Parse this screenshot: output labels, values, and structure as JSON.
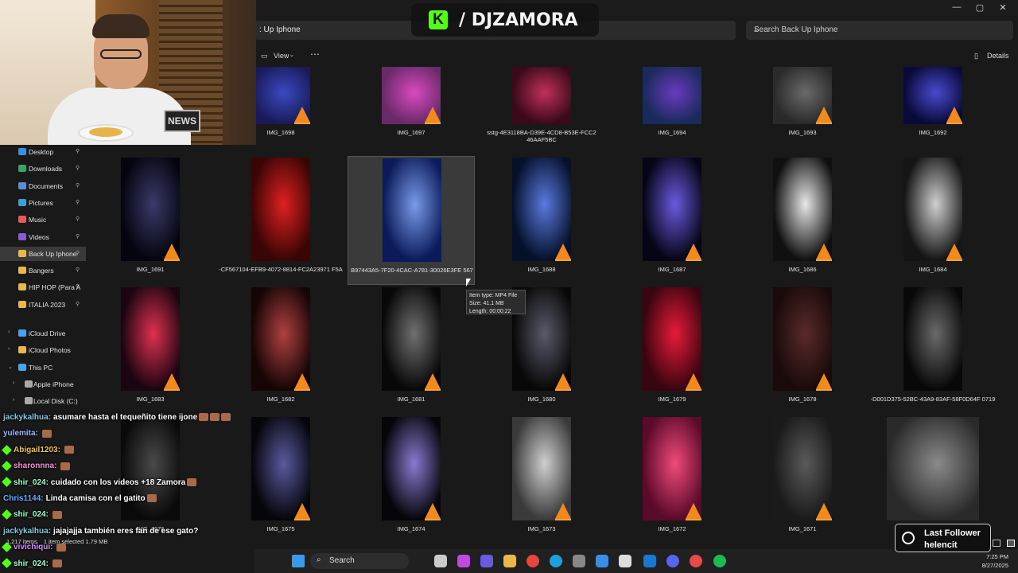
{
  "brand": {
    "name": "/ DJZAMORA",
    "logo_letter": "K",
    "accent": "#53fc18"
  },
  "window": {
    "minimize": "—",
    "maximize": "▢",
    "close": "✕"
  },
  "address": {
    "path": ": Up Iphone"
  },
  "search": {
    "placeholder": "Search Back Up Iphone",
    "icon": "search-icon"
  },
  "toolbar": {
    "view_label": "View",
    "more_label": "⋯",
    "details_label": "Details"
  },
  "webcam": {
    "sign_text": "NEWS"
  },
  "nav": {
    "quick_access": [
      {
        "label": "Desktop",
        "icon": "desktop-icon",
        "color": "#3a8ee6"
      },
      {
        "label": "Downloads",
        "icon": "download-icon",
        "color": "#3aa36b"
      },
      {
        "label": "Documents",
        "icon": "document-icon",
        "color": "#5a8fd6"
      },
      {
        "label": "Pictures",
        "icon": "picture-icon",
        "color": "#3aa0d8"
      },
      {
        "label": "Music",
        "icon": "music-icon",
        "color": "#e25a5a"
      },
      {
        "label": "Videos",
        "icon": "video-icon",
        "color": "#8a5ad6"
      },
      {
        "label": "Back Up Iphone",
        "icon": "folder-icon",
        "color": "#e8b84a",
        "selected": true
      },
      {
        "label": "Bangers",
        "icon": "folder-icon",
        "color": "#e8b84a"
      },
      {
        "label": "HIP HOP (Para A",
        "icon": "folder-icon",
        "color": "#e8b84a"
      },
      {
        "label": "ITALIA 2023",
        "icon": "folder-icon",
        "color": "#e8b84a"
      }
    ],
    "tree": [
      {
        "label": "iCloud Drive",
        "icon": "cloud-icon",
        "color": "#4aa3ea",
        "indent": 0,
        "chev": "›"
      },
      {
        "label": "iCloud Photos",
        "icon": "folder-icon",
        "color": "#e8b84a",
        "indent": 0,
        "chev": "›"
      },
      {
        "label": "This PC",
        "icon": "pc-icon",
        "color": "#4aa3ea",
        "indent": 0,
        "chev": "⌄"
      },
      {
        "label": "Apple iPhone",
        "icon": "phone-icon",
        "color": "#aaaaaa",
        "indent": 1,
        "chev": "›"
      },
      {
        "label": "Local Disk (C:)",
        "icon": "disk-icon",
        "color": "#aaaaaa",
        "indent": 1,
        "chev": "›"
      }
    ]
  },
  "files": [
    {
      "name": "IMG_1698",
      "colors": [
        "#1a1a5a",
        "#3a4ac0"
      ],
      "cone": true
    },
    {
      "name": "IMG_1697",
      "colors": [
        "#6a2a6a",
        "#d84ac0"
      ],
      "cone": true
    },
    {
      "name": "sstg-4E3118BA-D39E-4CD8-B53E-FCC2 46AAF5BC",
      "colors": [
        "#3a0a1a",
        "#c0305a"
      ],
      "cone": false
    },
    {
      "name": "IMG_1694",
      "colors": [
        "#1a2a5a",
        "#6a3ac0"
      ],
      "cone": false
    },
    {
      "name": "IMG_1693",
      "colors": [
        "#2a2a2a",
        "#6a6a6a"
      ],
      "cone": true
    },
    {
      "name": "IMG_1692",
      "colors": [
        "#0a0a3a",
        "#4a4ad0"
      ],
      "cone": true
    },
    {
      "name": "IMG_1691",
      "colors": [
        "#050510",
        "#3a3a6a"
      ],
      "cone": true
    },
    {
      "name": "-CF567104-EFB9-4072-8814-FC2A23971 F5A",
      "colors": [
        "#3a0505",
        "#e02020"
      ],
      "cone": false
    },
    {
      "name": "B97443A5-7F20-4CAC-A781-30026E3FE 567",
      "colors": [
        "#0a1a5a",
        "#7a9ae8"
      ],
      "cone": false,
      "selected": true
    },
    {
      "name": "IMG_1688",
      "colors": [
        "#05102a",
        "#5a7ae0"
      ],
      "cone": true
    },
    {
      "name": "IMG_1687",
      "colors": [
        "#050515",
        "#6a5ae0"
      ],
      "cone": true
    },
    {
      "name": "IMG_1686",
      "colors": [
        "#101010",
        "#e8e8e8"
      ],
      "cone": true
    },
    {
      "name": "IMG_1684",
      "colors": [
        "#151515",
        "#d0d0d0"
      ],
      "cone": true
    },
    {
      "name": "IMG_1683",
      "colors": [
        "#1a0510",
        "#e03050"
      ],
      "cone": true
    },
    {
      "name": "IMG_1682",
      "colors": [
        "#150505",
        "#b04040"
      ],
      "cone": true
    },
    {
      "name": "IMG_1681",
      "colors": [
        "#080808",
        "#707070"
      ],
      "cone": true
    },
    {
      "name": "IMG_1680",
      "colors": [
        "#080808",
        "#5a5a6a"
      ],
      "cone": true
    },
    {
      "name": "IMG_1679",
      "colors": [
        "#3a0510",
        "#e81a3a"
      ],
      "cone": true
    },
    {
      "name": "IMG_1678",
      "colors": [
        "#1a0a0a",
        "#5a2a2a"
      ],
      "cone": true
    },
    {
      "name": "-D001D375-52BC-43A9-83AF-58F0D64F 0719",
      "colors": [
        "#080808",
        "#6a6a6a"
      ],
      "cone": false
    },
    {
      "name": "IMG_1676",
      "colors": [
        "#0a0a0a",
        "#4a4a4a"
      ],
      "cone": false
    },
    {
      "name": "IMG_1675",
      "colors": [
        "#05050a",
        "#5a5aa0"
      ],
      "cone": true
    },
    {
      "name": "IMG_1674",
      "colors": [
        "#05050a",
        "#8a7ad0"
      ],
      "cone": true
    },
    {
      "name": "IMG_1673",
      "colors": [
        "#3a3a3a",
        "#d0d0d0"
      ],
      "cone": true
    },
    {
      "name": "IMG_1672",
      "colors": [
        "#5a0a2a",
        "#f04a7a"
      ],
      "cone": true
    },
    {
      "name": "IMG_1671",
      "colors": [
        "#1a1a1a",
        "#5a5a5a"
      ],
      "cone": true
    },
    {
      "name": "",
      "colors": [
        "#2a2a2a",
        "#8a8a8a"
      ],
      "cone": false
    }
  ],
  "tooltip": {
    "type": "Item type: MP4 File",
    "size": "Size: 41.1 MB",
    "length": "Length: 00:00:22"
  },
  "chat": [
    {
      "user": "jackykalhua:",
      "text": "asumare hasta el tequeñito tiene ijone",
      "color": "#7ec8e3",
      "badge": false,
      "emotes": 3
    },
    {
      "user": "yulemita:",
      "text": "",
      "color": "#9ab8ff",
      "badge": false,
      "emotes": 1
    },
    {
      "user": "Abigail1203:",
      "text": "",
      "color": "#f0c24a",
      "badge": true,
      "emotes": 1
    },
    {
      "user": "sharonnna:",
      "text": "",
      "color": "#ff8ad8",
      "badge": true,
      "emotes": 1
    },
    {
      "user": "shir_024:",
      "text": "cuidado con los videos +18 Zamora",
      "color": "#9affc4",
      "badge": true,
      "emotes": 1
    },
    {
      "user": "Chris1144:",
      "text": "Linda camisa con el gatito",
      "color": "#6aa8ff",
      "badge": false,
      "emotes": 1
    },
    {
      "user": "shir_024:",
      "text": "",
      "color": "#9affc4",
      "badge": true,
      "emotes": 1
    },
    {
      "user": "jackykalhua:",
      "text": "jajajajja también eres fan de ese gato?",
      "color": "#7ec8e3",
      "badge": false,
      "emotes": 0
    },
    {
      "user": "vivichiqui:",
      "text": "",
      "color": "#d08aff",
      "badge": true,
      "emotes": 1
    },
    {
      "user": "shir_024:",
      "text": "",
      "color": "#9affc4",
      "badge": true,
      "emotes": 1
    }
  ],
  "status_bar": {
    "items": "1,217 items",
    "selection": "1 item selected  1.79 MB"
  },
  "last_follower": {
    "title": "Last Follower",
    "name": "helencit"
  },
  "taskbar": {
    "search_label": "Search",
    "apps": [
      {
        "icon": "windows-icon",
        "color": "#3a9ae8"
      },
      {
        "icon": "task-view-icon",
        "color": "#cccccc"
      },
      {
        "icon": "copilot-icon",
        "color": "#c04ae0"
      },
      {
        "icon": "teams-icon",
        "color": "#6a5ae0"
      },
      {
        "icon": "file-explorer-icon",
        "color": "#e8b84a"
      },
      {
        "icon": "chrome-icon",
        "color": "#e8453c"
      },
      {
        "icon": "edge-icon",
        "color": "#1fa0d8"
      },
      {
        "icon": "app-icon",
        "color": "#888888"
      },
      {
        "icon": "store-icon",
        "color": "#3a8ee6"
      },
      {
        "icon": "capcut-icon",
        "color": "#dddddd"
      },
      {
        "icon": "outlook-icon",
        "color": "#1a78d0"
      },
      {
        "icon": "discord-icon",
        "color": "#5865f2"
      },
      {
        "icon": "app2-icon",
        "color": "#e84a4a"
      },
      {
        "icon": "spotify-icon",
        "color": "#1db954"
      }
    ],
    "time": "7:25 PM",
    "date": "8/27/2025"
  }
}
